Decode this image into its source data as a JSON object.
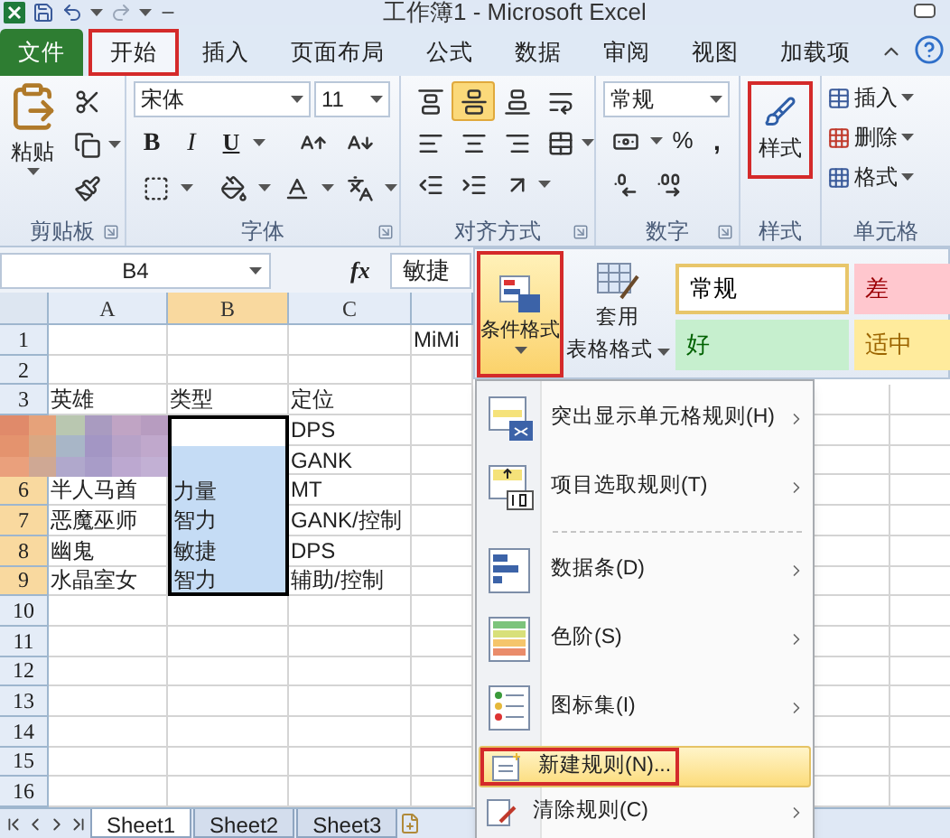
{
  "title_bar": {
    "title": "工作簿1 - Microsoft Excel"
  },
  "tabs": [
    {
      "label": "文件",
      "kind": "file",
      "selected": false,
      "outlined": false
    },
    {
      "label": "开始",
      "kind": "tab",
      "selected": true,
      "outlined": true
    },
    {
      "label": "插入",
      "kind": "tab",
      "selected": false,
      "outlined": false
    },
    {
      "label": "页面布局",
      "kind": "tab",
      "selected": false,
      "outlined": false
    },
    {
      "label": "公式",
      "kind": "tab",
      "selected": false,
      "outlined": false
    },
    {
      "label": "数据",
      "kind": "tab",
      "selected": false,
      "outlined": false
    },
    {
      "label": "审阅",
      "kind": "tab",
      "selected": false,
      "outlined": false
    },
    {
      "label": "视图",
      "kind": "tab",
      "selected": false,
      "outlined": false
    },
    {
      "label": "加载项",
      "kind": "tab",
      "selected": false,
      "outlined": false
    }
  ],
  "ribbon": {
    "clipboard": {
      "label": "剪贴板",
      "paste": "粘贴"
    },
    "font": {
      "label": "字体",
      "font_name": "宋体",
      "font_size": "11",
      "bold": "B",
      "italic": "I",
      "underline": "U"
    },
    "alignment": {
      "label": "对齐方式",
      "vertical_align": [
        {
          "selected": false
        },
        {
          "selected": true
        },
        {
          "selected": false
        }
      ]
    },
    "number": {
      "label": "数字",
      "format": "常规",
      "percent": "%",
      "comma": ","
    },
    "styles": {
      "label": "样式",
      "button_label": "样式",
      "outlined": true
    },
    "cells": {
      "label": "单元格",
      "buttons": [
        {
          "label": "插入",
          "kind": "insert"
        },
        {
          "label": "删除",
          "kind": "delete"
        },
        {
          "label": "格式",
          "kind": "format"
        }
      ]
    }
  },
  "style_gallery": {
    "conditional_format": {
      "label": "条件格式",
      "outlined": true,
      "selected": true
    },
    "table_format": {
      "line_1": "套用",
      "line_2": "表格格式"
    },
    "styles": [
      {
        "label": "常规",
        "kind": "normal"
      },
      {
        "label": "差",
        "kind": "bad"
      },
      {
        "label": "好",
        "kind": "good"
      },
      {
        "label": "适中",
        "kind": "neutral"
      }
    ]
  },
  "formula_bar": {
    "name_box": "B4",
    "function_label": "fx",
    "value": "敏捷"
  },
  "columns": [
    {
      "label": "A",
      "selected": false
    },
    {
      "label": "B",
      "selected": true
    },
    {
      "label": "C",
      "selected": false
    }
  ],
  "rows": [
    {
      "number": "1",
      "selected": false,
      "cells": [
        {
          "selected": false
        },
        {
          "selected": false
        },
        {
          "selected": false
        },
        {
          "text": "MiMi",
          "selected": false
        }
      ]
    },
    {
      "number": "2",
      "selected": false,
      "cells": [
        {
          "selected": false
        },
        {
          "selected": false
        },
        {
          "selected": false
        },
        {
          "selected": false
        }
      ]
    },
    {
      "number": "3",
      "selected": false,
      "cells": [
        {
          "text": "英雄",
          "selected": false
        },
        {
          "text": "类型",
          "selected": false
        },
        {
          "text": "定位",
          "selected": false
        },
        {
          "selected": false
        }
      ]
    },
    {
      "cells": [
        null,
        {
          "selected": true,
          "active": true
        },
        {
          "text": "DPS",
          "selected": false
        },
        {
          "selected": false
        }
      ]
    },
    {
      "cells": [
        null,
        {
          "selected": true,
          "active": false
        },
        {
          "text": "GANK",
          "selected": false
        },
        {
          "selected": false
        }
      ]
    },
    {
      "number": "6",
      "selected": true,
      "cells": [
        {
          "text": "半人马酋",
          "selected": false
        },
        {
          "text": "力量",
          "selected": true
        },
        {
          "text": "MT",
          "selected": false
        },
        {
          "selected": false
        }
      ]
    },
    {
      "number": "7",
      "selected": true,
      "cells": [
        {
          "text": "恶魔巫师",
          "selected": false
        },
        {
          "text": "智力",
          "selected": true
        },
        {
          "text": "GANK/控制",
          "selected": false
        },
        {
          "selected": false
        }
      ]
    },
    {
      "number": "8",
      "selected": true,
      "cells": [
        {
          "text": "幽鬼",
          "selected": false
        },
        {
          "text": "敏捷",
          "selected": true
        },
        {
          "text": "DPS",
          "selected": false
        },
        {
          "selected": false
        }
      ]
    },
    {
      "number": "9",
      "selected": true,
      "cells": [
        {
          "text": "水晶室女",
          "selected": false
        },
        {
          "text": "智力",
          "selected": true
        },
        {
          "text": "辅助/控制",
          "selected": false
        },
        {
          "selected": false
        }
      ]
    },
    {
      "number": "10",
      "selected": false
    },
    {
      "number": "11",
      "selected": false
    },
    {
      "number": "12",
      "selected": false
    },
    {
      "number": "13",
      "selected": false
    },
    {
      "number": "14",
      "selected": false
    },
    {
      "number": "15",
      "selected": false
    },
    {
      "number": "16",
      "selected": false
    }
  ],
  "sheet_tabs": [
    {
      "label": "Sheet1",
      "selected": true
    },
    {
      "label": "Sheet2",
      "selected": false
    },
    {
      "label": "Sheet3",
      "selected": false
    }
  ],
  "menu": {
    "items": [
      {
        "label": "突出显示单元格规则(H)",
        "kind": "highlight",
        "submenu": true,
        "selected": false,
        "outlined": false
      },
      {
        "label": "项目选取规则(T)",
        "kind": "top",
        "submenu": true,
        "selected": false,
        "outlined": false
      },
      {
        "kind": "separator"
      },
      {
        "label": "数据条(D)",
        "kind": "databar",
        "submenu": true,
        "selected": false,
        "outlined": false
      },
      {
        "label": "色阶(S)",
        "kind": "colorscale",
        "submenu": true,
        "selected": false,
        "outlined": false
      },
      {
        "label": "图标集(I)",
        "kind": "iconset",
        "submenu": true,
        "selected": false,
        "outlined": false
      },
      {
        "label": "新建规则(N)...",
        "kind": "new",
        "submenu": false,
        "selected": true,
        "outlined": true
      },
      {
        "label": "清除规则(C)",
        "kind": "clear",
        "submenu": true,
        "selected": false,
        "outlined": false
      }
    ]
  }
}
